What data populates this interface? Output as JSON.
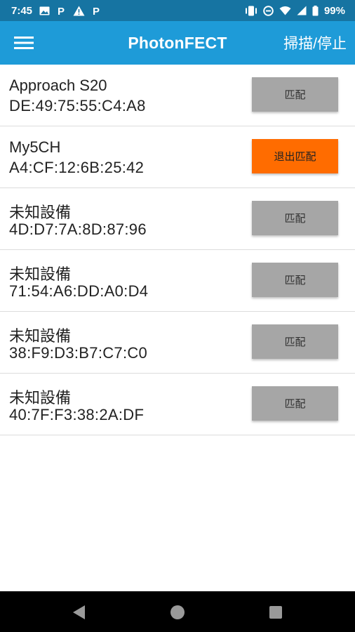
{
  "status_bar": {
    "time": "7:45",
    "notification_icons": [
      "image-icon",
      "parking-icon",
      "warning-icon",
      "parking-icon"
    ],
    "system_icons": [
      "vibrate-icon",
      "do-not-disturb-icon",
      "wifi-icon",
      "signal-icon",
      "battery-icon"
    ],
    "battery": "99%"
  },
  "app_bar": {
    "menu_icon": "hamburger-menu-icon",
    "title": "PhotonFECT",
    "scan_label": "掃描/停止"
  },
  "devices": [
    {
      "name": "Approach S20",
      "mac": "DE:49:75:55:C4:A8",
      "action": "匹配",
      "paired": false
    },
    {
      "name": "My5CH",
      "mac": "A4:CF:12:6B:25:42",
      "action": "退出匹配",
      "paired": true
    },
    {
      "name": "未知設備",
      "mac": "4D:D7:7A:8D:87:96",
      "action": "匹配",
      "paired": false
    },
    {
      "name": "未知設備",
      "mac": "71:54:A6:DD:A0:D4",
      "action": "匹配",
      "paired": false
    },
    {
      "name": "未知設備",
      "mac": "38:F9:D3:B7:C7:C0",
      "action": "匹配",
      "paired": false
    },
    {
      "name": "未知設備",
      "mac": "40:7F:F3:38:2A:DF",
      "action": "匹配",
      "paired": false
    }
  ],
  "colors": {
    "status_bar": "#1674a2",
    "app_bar": "#1e9bd8",
    "pair_button": "#a6a6a6",
    "unpair_button": "#ff6c00",
    "nav_bar": "#000000"
  },
  "nav_bar": {
    "icons": [
      "back-icon",
      "home-icon",
      "recents-icon"
    ]
  }
}
